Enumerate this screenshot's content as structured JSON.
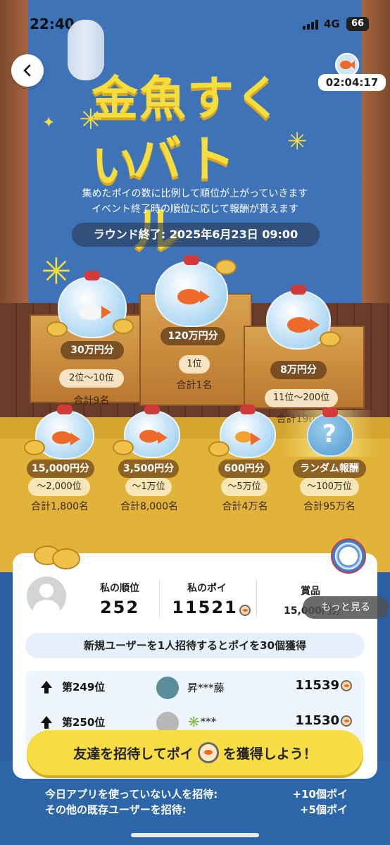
{
  "status_bar": {
    "time": "22:40",
    "network": "4G",
    "battery": "66"
  },
  "header": {
    "timer": "02:04:17",
    "title_line1": "金魚すくい",
    "title_line2": "バトル"
  },
  "intro": {
    "line1": "集めたポイの数に比例して順位が上がっていきます",
    "line2": "イベント終了時の順位に応じて報酬が貰えます",
    "round_end": "ラウンド終了: 2025年6月23日 09:00"
  },
  "prizes": {
    "first": {
      "reward": "120万円分",
      "rank": "1位",
      "total": "合計1名"
    },
    "second": {
      "reward": "30万円分",
      "rank": "2位〜10位",
      "total": "合計9名"
    },
    "third": {
      "reward": "8万円分",
      "rank": "11位〜200位",
      "total": "合計190名"
    },
    "tier4": {
      "reward": "15,000円分",
      "rank": "〜2,000位",
      "total": "合計1,800名"
    },
    "tier5": {
      "reward": "3,500円分",
      "rank": "〜1万位",
      "total": "合計8,000名"
    },
    "tier6": {
      "reward": "600円分",
      "rank": "〜5万位",
      "total": "合計4万名"
    },
    "tier7": {
      "reward": "ランダム報酬",
      "rank": "〜100万位",
      "total": "合計95万名"
    }
  },
  "my_stats": {
    "rank_label": "私の順位",
    "rank_value": "252",
    "poi_label": "私のポイ",
    "poi_value": "11521",
    "prize_label": "賞品",
    "prize_value": "15,000円分",
    "more_button": "もっと見る"
  },
  "invite_banner": "新規ユーザーを1人招待するとポイを30個獲得",
  "ranking": [
    {
      "rank": "第249位",
      "name": "昇***藤",
      "poi": "11539"
    },
    {
      "rank": "第250位",
      "name": "✳️***",
      "poi": "11530"
    }
  ],
  "cta": {
    "before": "友達を招待してポイ",
    "after": "を獲得しよう！"
  },
  "footer": {
    "row1_label": "今日アプリを使っていない人を招待:",
    "row1_value": "+10個ポイ",
    "row2_label": "その他の既存ユーザーを招待:",
    "row2_value": "+5個ポイ"
  },
  "colors": {
    "accent_yellow": "#f6dd3e",
    "bg_blue": "#3f73b8",
    "floor": "#e1b439"
  },
  "icons": [
    "back-icon",
    "goldfish-icon",
    "poi-icon",
    "arrow-up-icon",
    "lantern-icon",
    "coins-icon"
  ]
}
